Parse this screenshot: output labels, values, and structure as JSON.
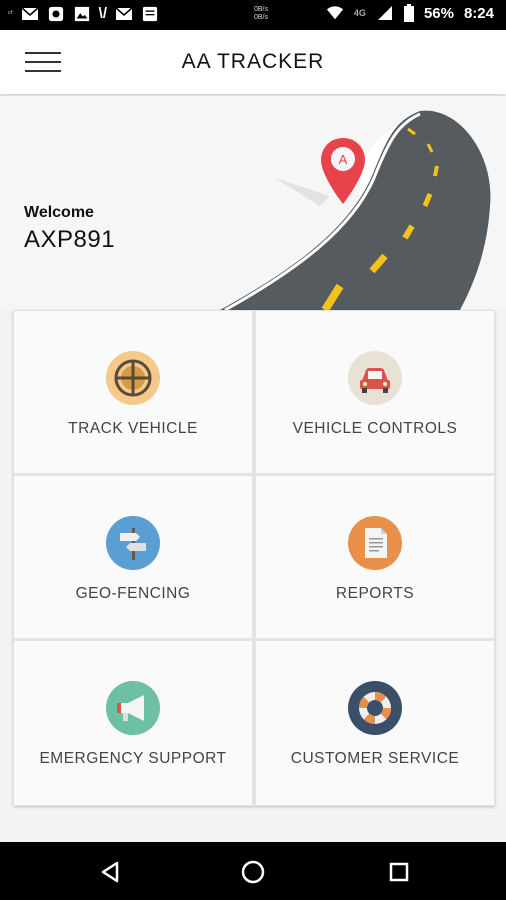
{
  "status_bar": {
    "battery": "56%",
    "time": "8:24",
    "network": "4G",
    "net_speed_top": "0B/s",
    "net_speed_bottom": "0B/s"
  },
  "app_bar": {
    "title": "AA TRACKER"
  },
  "hero": {
    "welcome_label": "Welcome",
    "vehicle_id": "AXP891"
  },
  "tiles": [
    {
      "label": "TRACK VEHICLE",
      "icon": "crosshair-icon",
      "color": "#f5c98a"
    },
    {
      "label": "VEHICLE CONTROLS",
      "icon": "car-icon",
      "color": "#e7e2d3"
    },
    {
      "label": "GEO-FENCING",
      "icon": "signpost-icon",
      "color": "#5a9fd4"
    },
    {
      "label": "REPORTS",
      "icon": "document-icon",
      "color": "#e8904a"
    },
    {
      "label": "EMERGENCY SUPPORT",
      "icon": "megaphone-icon",
      "color": "#6cc0a3"
    },
    {
      "label": "CUSTOMER SERVICE",
      "icon": "lifebuoy-icon",
      "color": "#3b5068"
    }
  ],
  "colors": {
    "road": "#555a5f",
    "road_stripe": "#f5c21b",
    "pin": "#e8434a"
  }
}
